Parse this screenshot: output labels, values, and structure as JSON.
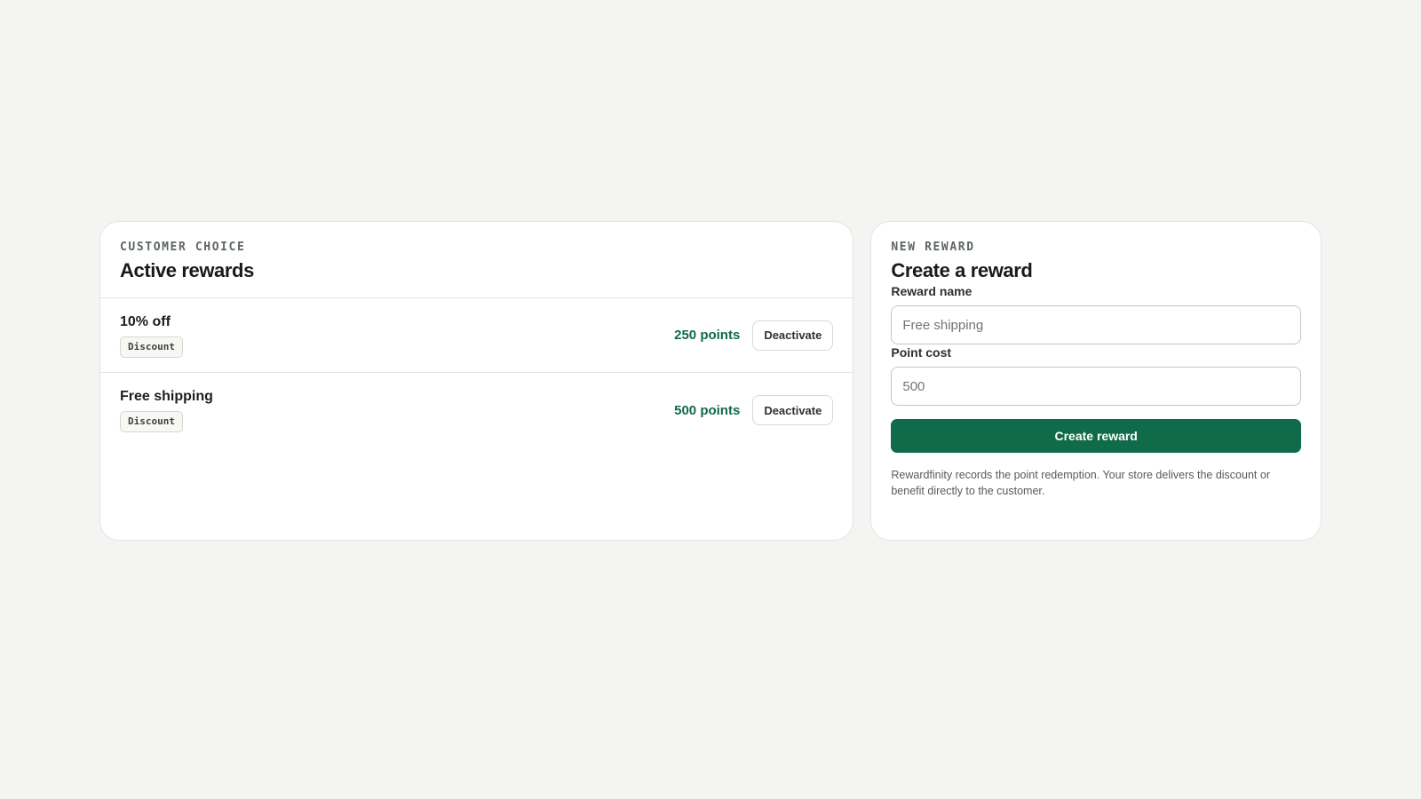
{
  "rewards_panel": {
    "eyebrow": "CUSTOMER CHOICE",
    "title": "Active rewards",
    "items": [
      {
        "name": "10% off",
        "tag": "Discount",
        "points": "250 points",
        "action": "Deactivate"
      },
      {
        "name": "Free shipping",
        "tag": "Discount",
        "points": "500 points",
        "action": "Deactivate"
      }
    ]
  },
  "form_panel": {
    "eyebrow": "NEW REWARD",
    "title": "Create a reward",
    "name_label": "Reward name",
    "name_placeholder": "Free shipping",
    "cost_label": "Point cost",
    "cost_placeholder": "500",
    "submit_label": "Create reward",
    "note": "Rewardfinity records the point redemption. Your store delivers the discount or benefit directly to the customer."
  },
  "colors": {
    "accent": "#106b4a",
    "points_text": "#106b49",
    "background": "#f4f4f2"
  }
}
